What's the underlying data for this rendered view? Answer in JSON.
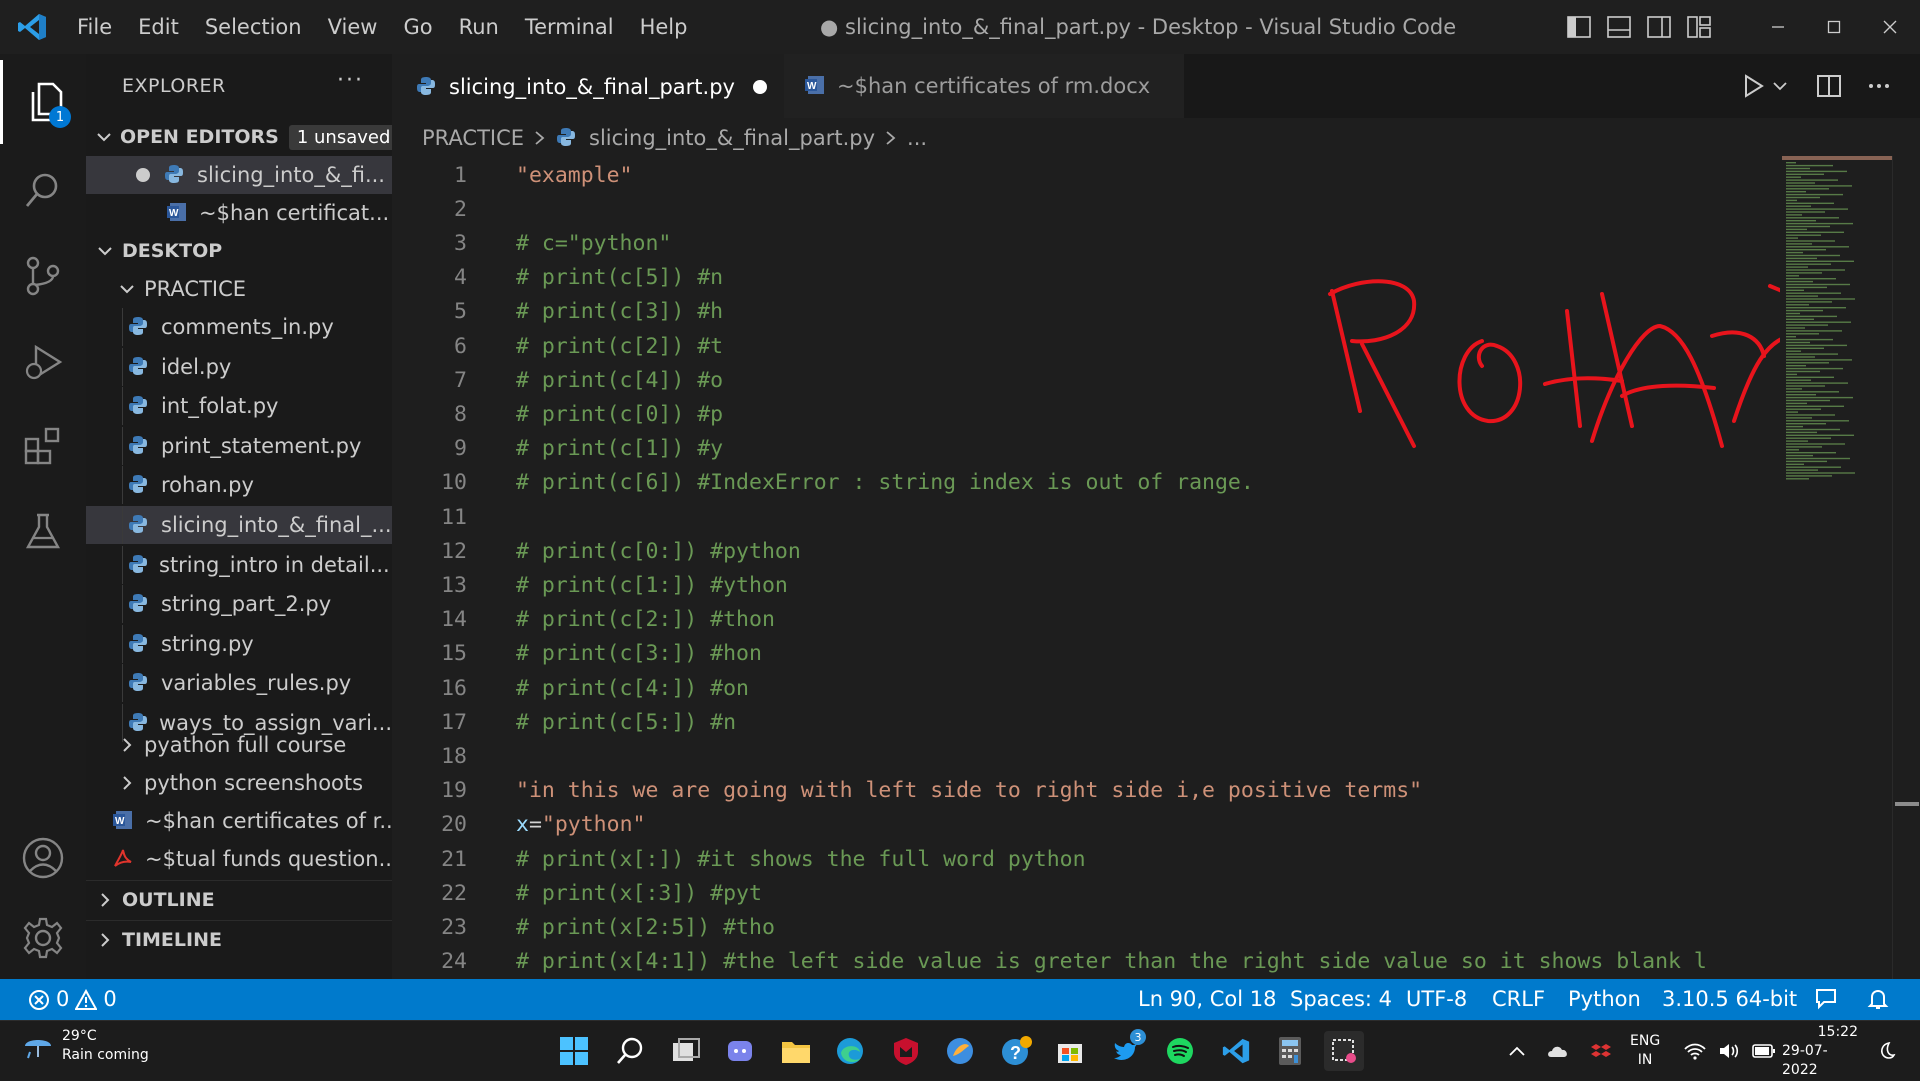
{
  "window": {
    "title": "● slicing_into_&_final_part.py - Desktop - Visual Studio Code",
    "menu": [
      "File",
      "Edit",
      "Selection",
      "View",
      "Go",
      "Run",
      "Terminal",
      "Help"
    ]
  },
  "activity_bar": {
    "explorer_badge": "1"
  },
  "sidebar": {
    "title": "EXPLORER",
    "more": "···",
    "open_editors": {
      "label": "OPEN EDITORS",
      "badge": "1 unsaved",
      "items": [
        {
          "name": "slicing_into_&_fi...",
          "type": "python",
          "unsaved": true
        },
        {
          "name": "~$han certificat...",
          "type": "word",
          "unsaved": false
        }
      ]
    },
    "desktop": {
      "label": "DESKTOP",
      "folder": "PRACTICE",
      "files": [
        "comments_in.py",
        "idel.py",
        "int_folat.py",
        "print_statement.py",
        "rohan.py",
        "slicing_into_&_final_...",
        "string_intro in detail....",
        "string_part_2.py",
        "string.py",
        "variables_rules.py",
        "ways_to_assign_vari..."
      ],
      "folders": [
        "pyathon full course",
        "python screenshoots"
      ],
      "other_files": [
        {
          "name": "~$han certificates of r...",
          "type": "word"
        },
        {
          "name": "~$tual funds question...",
          "type": "pdf"
        }
      ]
    },
    "outline": "OUTLINE",
    "timeline": "TIMELINE"
  },
  "tabs": [
    {
      "label": "slicing_into_&_final_part.py",
      "active": true,
      "unsaved": true,
      "type": "python"
    },
    {
      "label": "~$han certificates of rm.docx",
      "active": false,
      "unsaved": false,
      "type": "word"
    }
  ],
  "breadcrumb": {
    "folder": "PRACTICE",
    "file": "slicing_into_&_final_part.py",
    "more": "..."
  },
  "editor": {
    "lines": [
      {
        "n": "1",
        "kind": "string",
        "text": "\"example\""
      },
      {
        "n": "2",
        "kind": "plain",
        "text": ""
      },
      {
        "n": "3",
        "kind": "comment",
        "text": "# c=\"python\""
      },
      {
        "n": "4",
        "kind": "comment",
        "text": "# print(c[5]) #n"
      },
      {
        "n": "5",
        "kind": "comment",
        "text": "# print(c[3]) #h"
      },
      {
        "n": "6",
        "kind": "comment",
        "text": "# print(c[2]) #t"
      },
      {
        "n": "7",
        "kind": "comment",
        "text": "# print(c[4]) #o"
      },
      {
        "n": "8",
        "kind": "comment",
        "text": "# print(c[0]) #p"
      },
      {
        "n": "9",
        "kind": "comment",
        "text": "# print(c[1]) #y"
      },
      {
        "n": "10",
        "kind": "comment",
        "text": "# print(c[6]) #IndexError : string index is out of range."
      },
      {
        "n": "11",
        "kind": "plain",
        "text": ""
      },
      {
        "n": "12",
        "kind": "comment",
        "text": "# print(c[0:]) #python"
      },
      {
        "n": "13",
        "kind": "comment",
        "text": "# print(c[1:]) #ython"
      },
      {
        "n": "14",
        "kind": "comment",
        "text": "# print(c[2:]) #thon"
      },
      {
        "n": "15",
        "kind": "comment",
        "text": "# print(c[3:]) #hon"
      },
      {
        "n": "16",
        "kind": "comment",
        "text": "# print(c[4:]) #on"
      },
      {
        "n": "17",
        "kind": "comment",
        "text": "# print(c[5:]) #n"
      },
      {
        "n": "18",
        "kind": "plain",
        "text": ""
      },
      {
        "n": "19",
        "kind": "string",
        "text": "\"in this we are going with left side to right side i,e positive terms\""
      },
      {
        "n": "20",
        "kind": "assign",
        "var": "x",
        "op": "=",
        "value": "\"python\""
      },
      {
        "n": "21",
        "kind": "comment",
        "text": "# print(x[:]) #it shows the full word python"
      },
      {
        "n": "22",
        "kind": "comment",
        "text": "# print(x[:3]) #pyt"
      },
      {
        "n": "23",
        "kind": "comment",
        "text": "# print(x[2:5]) #tho"
      },
      {
        "n": "24",
        "kind": "comment",
        "text": "# print(x[4:1]) #the left side value is greter than the right side value so it shows blank l"
      }
    ],
    "annotation": {
      "text": "ROHAN",
      "color": "#e8141c"
    }
  },
  "statusbar": {
    "errors": "0",
    "warnings": "0",
    "position": "Ln 90, Col 18",
    "spaces": "Spaces: 4",
    "encoding": "UTF-8",
    "eol": "CRLF",
    "language": "Python",
    "interpreter": "3.10.5 64-bit"
  },
  "taskbar": {
    "weather_temp": "29°C",
    "weather_desc": "Rain coming",
    "lang_1": "ENG",
    "lang_2": "IN",
    "time": "15:22",
    "date": "29-07-2022",
    "twitter_badge": "3"
  },
  "colors": {
    "accent": "#007acc",
    "comment": "#6a9955",
    "string": "#ce9178",
    "variable": "#9cdcfe"
  }
}
